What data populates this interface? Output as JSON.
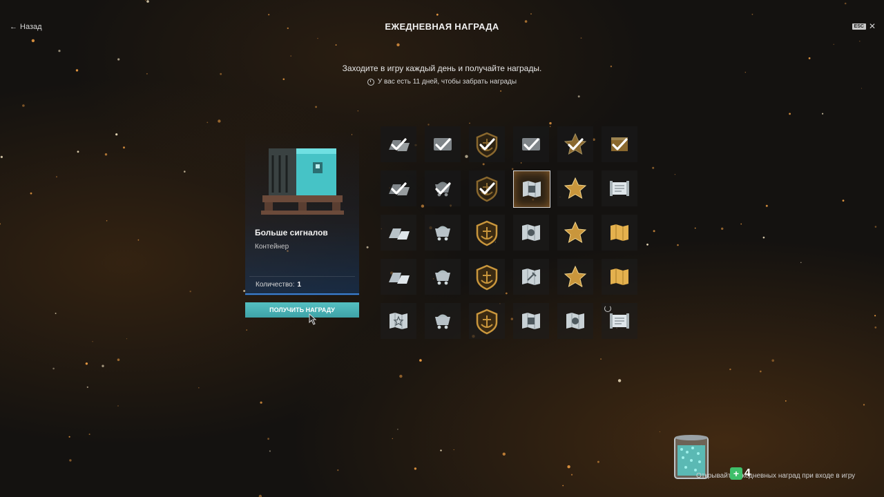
{
  "header": {
    "back_label": "Назад",
    "title": "ЕЖЕДНЕВНАЯ НАГРАДА",
    "esc_label": "ESC",
    "close_glyph": "✕"
  },
  "intro": {
    "subtitle": "Заходите в игру каждый день и получайте награды.",
    "days_left": "У вас есть 11 дней, чтобы забрать награды"
  },
  "selected_reward": {
    "name": "Больше сигналов",
    "type": "Контейнер",
    "quantity_label": "Количество:",
    "quantity_value": "1",
    "claim_button": "ПОЛУЧИТЬ НАГРАДУ"
  },
  "reward_grid": {
    "columns": 6,
    "rows": [
      [
        "silver-claimed",
        "container-claimed",
        "anchor-claimed",
        "document-claimed",
        "star-claimed",
        "gold-claimed"
      ],
      [
        "silver-claimed",
        "mine-cart-claimed",
        "anchor-claimed",
        "map-current",
        "star",
        "scroll-silver"
      ],
      [
        "silver",
        "mine-cart",
        "anchor",
        "map-skull",
        "star",
        "gold-map"
      ],
      [
        "silver",
        "mine-cart",
        "anchor",
        "map-hammer",
        "star",
        "gold-map"
      ],
      [
        "map-star",
        "mine-cart",
        "anchor",
        "map-document",
        "map-skull",
        "document-loading"
      ]
    ]
  },
  "footer": {
    "text": "Открывайте ежедневных наград при входе в игру",
    "badge_plus": "+",
    "badge_count": "4"
  },
  "colors": {
    "accent_teal": "#4bb3b6",
    "gold": "#c9963c",
    "silver": "#b8c2c8",
    "blue_line": "#3c7fd0"
  }
}
